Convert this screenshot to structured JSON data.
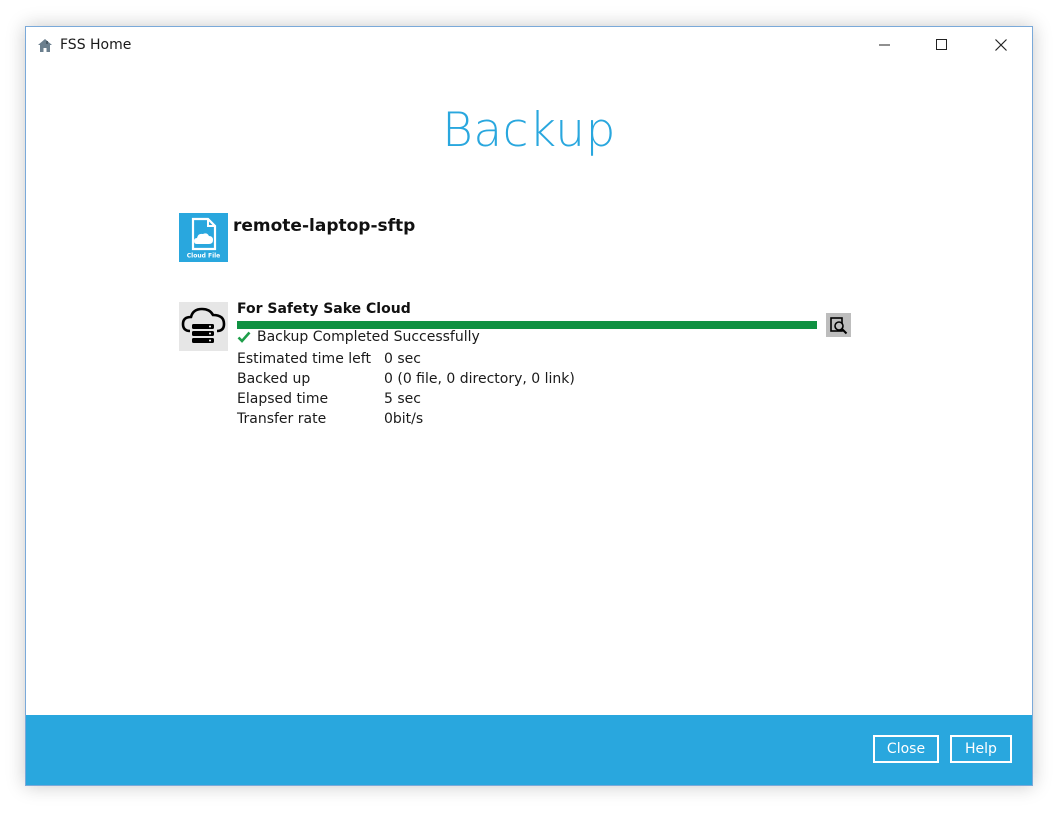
{
  "window": {
    "title": "FSS Home",
    "app_icon": "home-icon",
    "controls": [
      "minimize-icon",
      "maximize-icon",
      "close-icon"
    ]
  },
  "page": {
    "title": "Backup"
  },
  "backup_set": {
    "name": "remote-laptop-sftp",
    "icon": "cloud-file-icon",
    "icon_caption": "Cloud File"
  },
  "destination": {
    "name": "For Safety Sake Cloud",
    "icon": "cloud-server-icon",
    "progress": 1.0,
    "status": "Backup Completed Successfully",
    "status_icon": "checkmark-icon",
    "details_button": "detail-magnifier-icon",
    "stats": [
      {
        "label": "Estimated time left",
        "value": "0 sec"
      },
      {
        "label": "Backed up",
        "value": "0 (0 file, 0 directory, 0 link)"
      },
      {
        "label": "Elapsed time",
        "value": "5 sec"
      },
      {
        "label": "Transfer rate",
        "value": "0bit/s"
      }
    ]
  },
  "footer": {
    "close_label": "Close",
    "help_label": "Help"
  },
  "colors": {
    "accent": "#29a7de",
    "progress": "#0f9142",
    "success": "#1e9e4a"
  }
}
